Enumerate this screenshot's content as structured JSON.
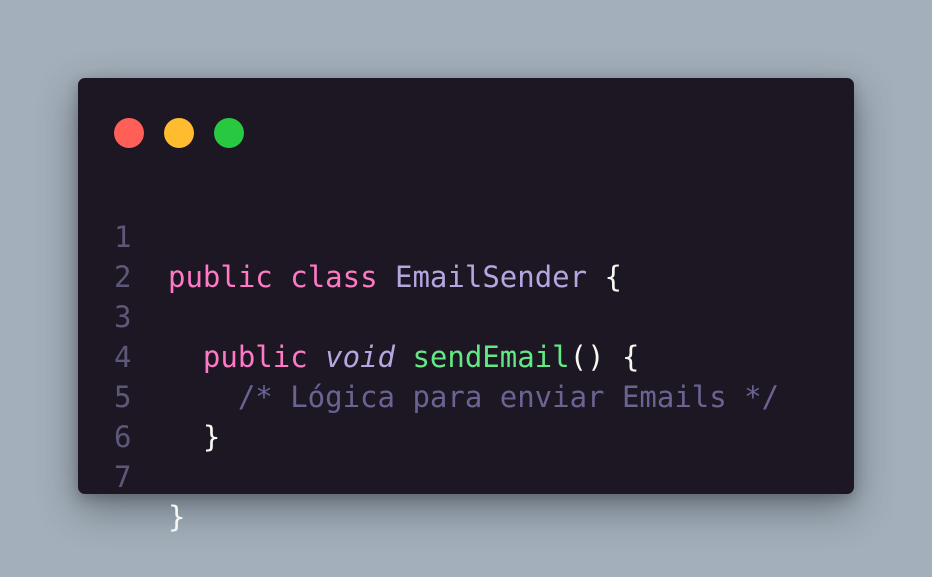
{
  "window": {
    "controls": [
      "close",
      "minimize",
      "maximize"
    ],
    "colors": {
      "background": "#1c1722",
      "close": "#ff5f57",
      "minimize": "#febc2e",
      "maximize": "#28c840",
      "keyword": "#ff79c6",
      "class_name": "#b6a6e0",
      "function": "#62e884",
      "comment": "#6b6392",
      "line_number": "#5e577a"
    }
  },
  "code": {
    "lines": [
      {
        "number": "1",
        "tokens": [
          {
            "type": "kw",
            "text": "public"
          },
          {
            "type": "pun",
            "text": " "
          },
          {
            "type": "kw",
            "text": "class"
          },
          {
            "type": "pun",
            "text": " "
          },
          {
            "type": "cls",
            "text": "EmailSender"
          },
          {
            "type": "pun",
            "text": " {"
          }
        ]
      },
      {
        "number": "2",
        "tokens": []
      },
      {
        "number": "3",
        "tokens": [
          {
            "type": "pun",
            "text": "  "
          },
          {
            "type": "kw",
            "text": "public"
          },
          {
            "type": "pun",
            "text": " "
          },
          {
            "type": "type",
            "text": "void"
          },
          {
            "type": "pun",
            "text": " "
          },
          {
            "type": "fn",
            "text": "sendEmail"
          },
          {
            "type": "pun",
            "text": "() {"
          }
        ]
      },
      {
        "number": "4",
        "tokens": [
          {
            "type": "pun",
            "text": "    "
          },
          {
            "type": "cmt",
            "text": "/* Lógica para enviar Emails */"
          }
        ]
      },
      {
        "number": "5",
        "tokens": [
          {
            "type": "pun",
            "text": "  }"
          }
        ]
      },
      {
        "number": "6",
        "tokens": []
      },
      {
        "number": "7",
        "tokens": [
          {
            "type": "pun",
            "text": "}"
          }
        ]
      }
    ]
  }
}
